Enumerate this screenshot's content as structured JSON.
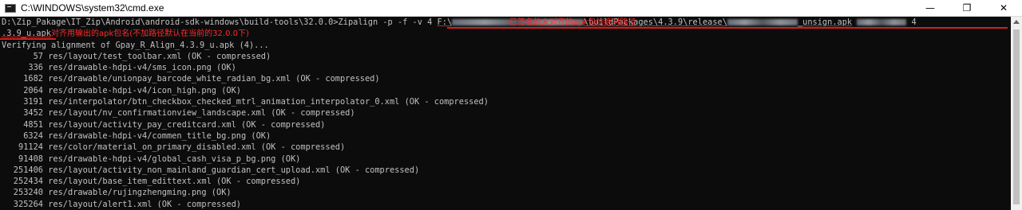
{
  "window": {
    "title": "C:\\WINDOWS\\system32\\cmd.exe",
    "minimize_glyph": "—",
    "maximize_glyph": "❐",
    "close_glyph": "✕",
    "icon": "cmd-icon"
  },
  "command": {
    "prefix": "D:\\Zip_Pakage\\IT_Zip\\Android\\android-sdk-windows\\build-tools\\32.0.0>Zipalign -p -f -v 4 ",
    "drive": "F:\\",
    "mid": "\\buildPackages\\4.3.9\\release\\",
    "suffix": "_unsign.apk",
    "tail": "4",
    "continuation": ".3.9_u.apk"
  },
  "annotations": {
    "output_apk_note": "对齐用输出的apk包名(不加路径默认在当前的32.0.0下)",
    "source_apk_note": "已签名的未对齐的apk包的绝对路径"
  },
  "verify_line": "Verifying alignment of Gpay_R_Align_4.3.9_u.apk (4)...",
  "entries": [
    {
      "offset": "57",
      "path": "res/layout/test_toolbar.xml",
      "status": "(OK - compressed)"
    },
    {
      "offset": "336",
      "path": "res/drawable-hdpi-v4/sms_icon.png",
      "status": "(OK)"
    },
    {
      "offset": "1682",
      "path": "res/drawable/unionpay_barcode_white_radian_bg.xml",
      "status": "(OK - compressed)"
    },
    {
      "offset": "2064",
      "path": "res/drawable-hdpi-v4/icon_high.png",
      "status": "(OK)"
    },
    {
      "offset": "3191",
      "path": "res/interpolator/btn_checkbox_checked_mtrl_animation_interpolator_0.xml",
      "status": "(OK - compressed)"
    },
    {
      "offset": "3452",
      "path": "res/layout/nv_confirmationview_landscape.xml",
      "status": "(OK - compressed)"
    },
    {
      "offset": "4851",
      "path": "res/layout/activity_pay_creditcard.xml",
      "status": "(OK - compressed)"
    },
    {
      "offset": "6324",
      "path": "res/drawable-hdpi-v4/commen_title_bg.png",
      "status": "(OK)"
    },
    {
      "offset": "91124",
      "path": "res/color/material_on_primary_disabled.xml",
      "status": "(OK - compressed)"
    },
    {
      "offset": "91408",
      "path": "res/drawable-hdpi-v4/global_cash_visa_p_bg.png",
      "status": "(OK)"
    },
    {
      "offset": "251406",
      "path": "res/layout/activity_non_mainland_guardian_cert_upload.xml",
      "status": "(OK - compressed)"
    },
    {
      "offset": "252434",
      "path": "res/layout/base_item_edittext.xml",
      "status": "(OK - compressed)"
    },
    {
      "offset": "253240",
      "path": "res/drawable/rujingzhengming.png",
      "status": "(OK)"
    },
    {
      "offset": "325264",
      "path": "res/layout/alert1.xml",
      "status": "(OK - compressed)"
    }
  ],
  "colors": {
    "console_bg": "#0c0c0c",
    "console_fg": "#c0c0c0",
    "annotation": "#ff2a2a"
  }
}
